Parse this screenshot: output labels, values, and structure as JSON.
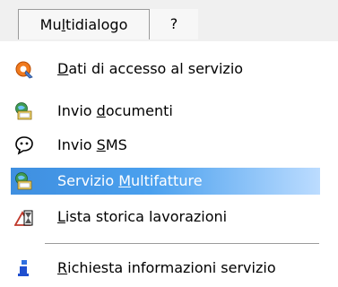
{
  "menubar": {
    "items": [
      {
        "pre": "Mu",
        "accel": "l",
        "post": "tidialogo"
      },
      {
        "label": "?"
      }
    ]
  },
  "menu": {
    "items": [
      {
        "pre": "",
        "accel": "D",
        "post": "ati di accesso al servizio",
        "icon": "key-access-icon"
      },
      {
        "pre": "Invio ",
        "accel": "d",
        "post": "ocumenti",
        "icon": "document-send-icon"
      },
      {
        "pre": "Invio ",
        "accel": "S",
        "post": "MS",
        "icon": "sms-phone-icon"
      },
      {
        "pre": "Servizio ",
        "accel": "M",
        "post": "ultifatture",
        "icon": "multifatture-icon",
        "highlighted": true
      },
      {
        "pre": "",
        "accel": "L",
        "post": "ista storica lavorazioni",
        "icon": "hourglass-history-icon"
      },
      {
        "pre": "",
        "accel": "R",
        "post": "ichiesta informazioni servizio",
        "icon": "info-request-icon"
      }
    ]
  },
  "colors": {
    "highlight_start": "#3f8fe0",
    "highlight_end": "#bcdcff",
    "menubar_bg": "#f0f0f0"
  }
}
